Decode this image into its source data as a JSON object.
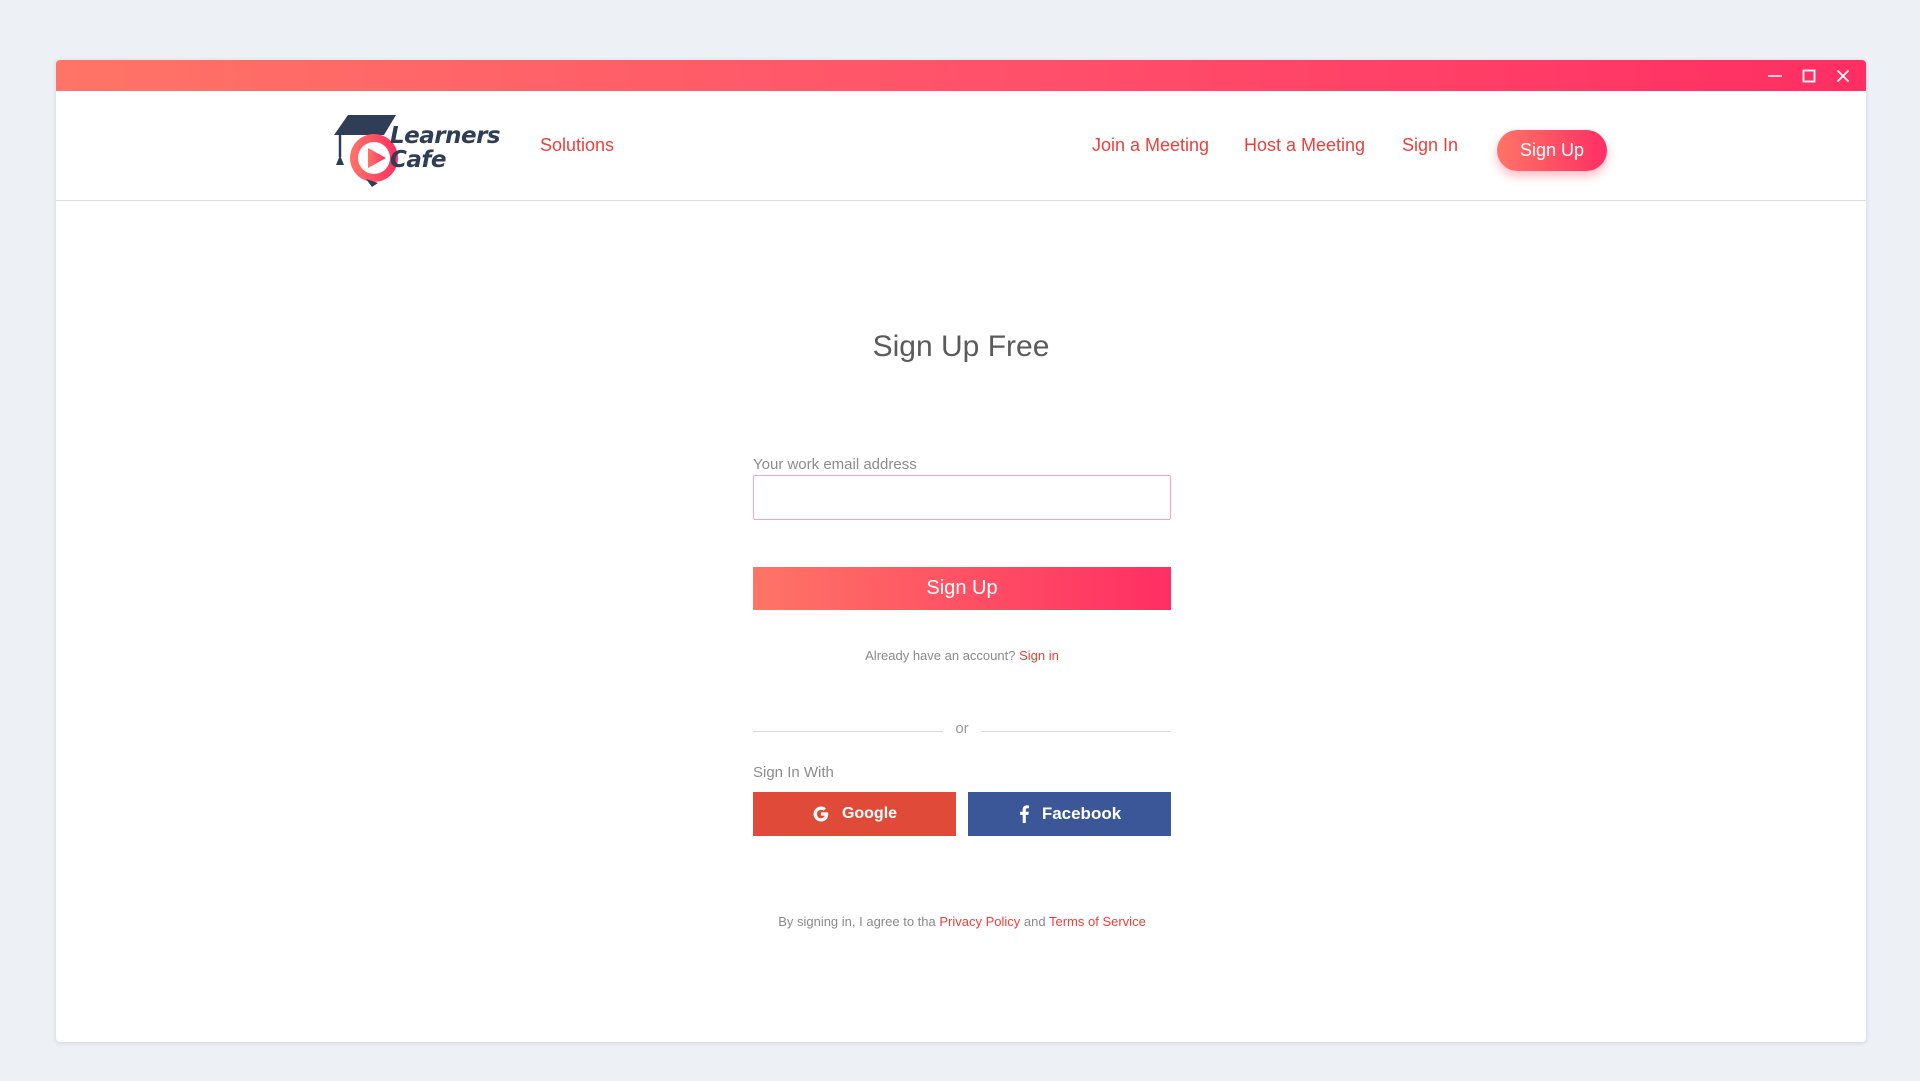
{
  "window": {
    "controls": {
      "minimize_icon": "minimize-icon",
      "maximize_icon": "maximize-icon",
      "close_icon": "close-icon"
    }
  },
  "brand": {
    "name_line1": "Learners",
    "name_line2": "Cafe",
    "logo_icon": "graduation-cap-play-icon"
  },
  "nav": {
    "solutions": "Solutions",
    "join_meeting": "Join a Meeting",
    "host_meeting": "Host a Meeting",
    "sign_in": "Sign In",
    "sign_up": "Sign Up"
  },
  "form": {
    "title": "Sign Up Free",
    "email_label": "Your work email address",
    "email_value": "",
    "submit_label": "Sign Up",
    "already_text": "Already have an account?",
    "sign_in_link": "Sign in",
    "divider_text": "or",
    "sign_in_with": "Sign In With",
    "google_label": "Google",
    "facebook_label": "Facebook"
  },
  "legal": {
    "prefix": "By signing in, I agree to tha",
    "privacy": "Privacy Policy",
    "and": "and",
    "terms": "Terms of Service"
  },
  "colors": {
    "accent": "#ef3e3a",
    "gradient_start": "#ff7466",
    "gradient_end": "#ff2e63",
    "google": "#e04a38",
    "facebook": "#3b5797",
    "logo_dark": "#2f3e56"
  }
}
